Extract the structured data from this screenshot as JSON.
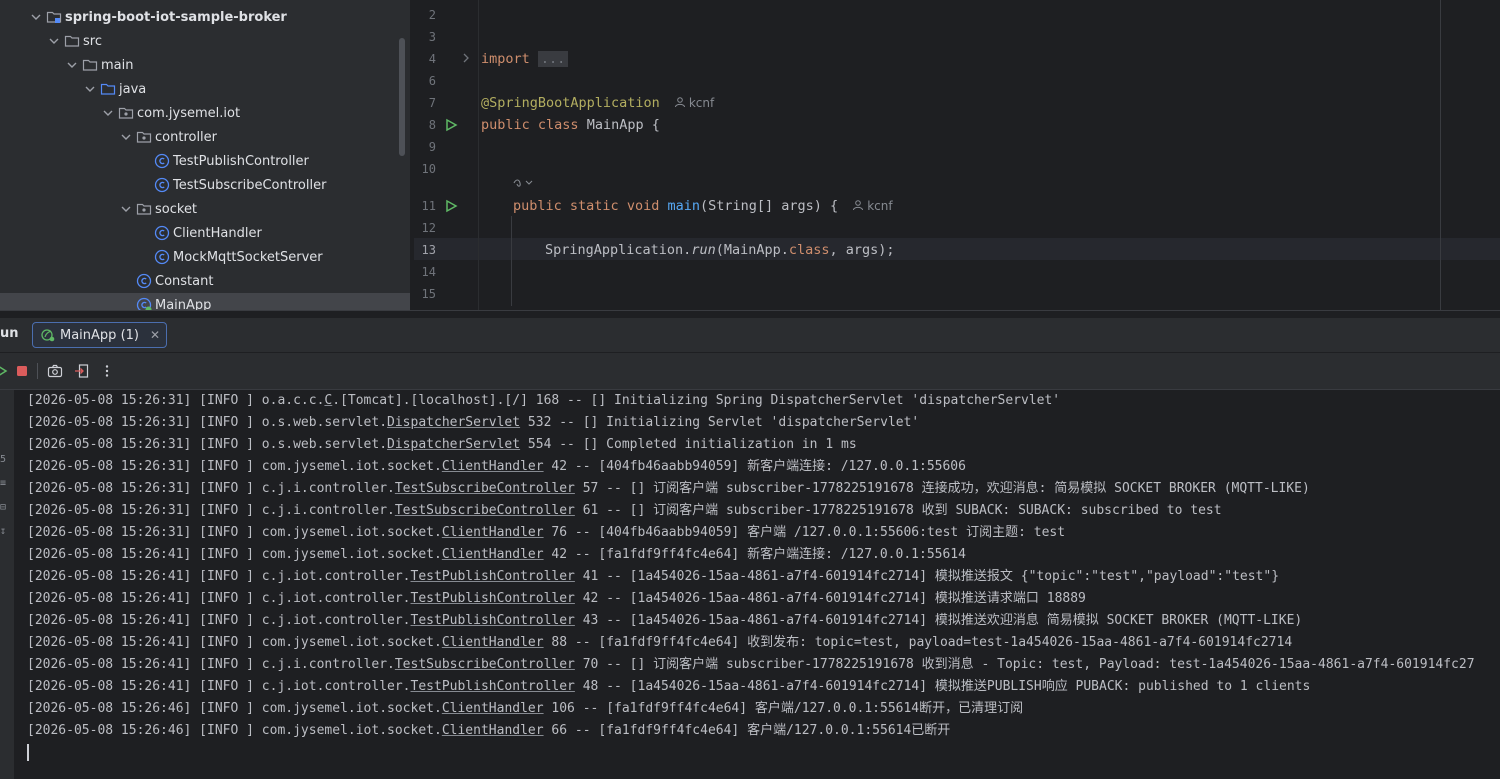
{
  "project_tree": {
    "items": [
      {
        "label": "spring-boot-iot-sample-broker",
        "icon": "module-folder-icon"
      },
      {
        "label": "src",
        "icon": "folder-icon"
      },
      {
        "label": "main",
        "icon": "folder-icon"
      },
      {
        "label": "java",
        "icon": "source-folder-icon"
      },
      {
        "label": "com.jysemel.iot",
        "icon": "package-icon"
      },
      {
        "label": "controller",
        "icon": "package-icon"
      },
      {
        "label": "TestPublishController",
        "icon": "class-icon"
      },
      {
        "label": "TestSubscribeController",
        "icon": "class-icon"
      },
      {
        "label": "socket",
        "icon": "package-icon"
      },
      {
        "label": "ClientHandler",
        "icon": "class-icon"
      },
      {
        "label": "MockMqttSocketServer",
        "icon": "class-icon"
      },
      {
        "label": "Constant",
        "icon": "class-icon"
      },
      {
        "label": "MainApp",
        "icon": "spring-class-icon"
      }
    ]
  },
  "editor": {
    "line_numbers": [
      "2",
      "3",
      "4",
      "6",
      "7",
      "8",
      "9",
      "10",
      "11",
      "12",
      "13",
      "14",
      "15"
    ],
    "import_kw": "import",
    "import_fold": "...",
    "annotation": "@SpringBootApplication",
    "author_hint": "kcnf",
    "class_decl": {
      "public": "public",
      "class": "class",
      "name": " MainApp {"
    },
    "method_decl": {
      "public": "public",
      "static": "static",
      "void": "void",
      "name": "main",
      "params": "(String[] args) {"
    },
    "run_stmt": {
      "obj": "SpringApplication.",
      "method": "run",
      "arg1": "(MainApp.",
      "kw": "class",
      "rest": ", args);"
    }
  },
  "run_window": {
    "title": "un",
    "tab_label": "MainApp (1)",
    "tab_close": "✕"
  },
  "console": {
    "lines": [
      {
        "pre": "[2026-05-08 15:26:31] [INFO ] o.a.c.c.",
        "cls": "C",
        "post": ".[Tomcat].[localhost].[/] 168 -- [] Initializing Spring DispatcherServlet 'dispatcherServlet'"
      },
      {
        "pre": "[2026-05-08 15:26:31] [INFO ] o.s.web.servlet.",
        "cls": "DispatcherServlet",
        "post": " 532 -- [] Initializing Servlet 'dispatcherServlet'"
      },
      {
        "pre": "[2026-05-08 15:26:31] [INFO ] o.s.web.servlet.",
        "cls": "DispatcherServlet",
        "post": " 554 -- [] Completed initialization in 1 ms"
      },
      {
        "pre": "[2026-05-08 15:26:31] [INFO ] com.jysemel.iot.socket.",
        "cls": "ClientHandler",
        "post": " 42 -- [404fb46aabb94059] 新客户端连接: /127.0.0.1:55606"
      },
      {
        "pre": "[2026-05-08 15:26:31] [INFO ] c.j.i.controller.",
        "cls": "TestSubscribeController",
        "post": " 57 -- [] 订阅客户端 subscriber-1778225191678 连接成功，欢迎消息: 简易模拟 SOCKET BROKER (MQTT-LIKE)"
      },
      {
        "pre": "[2026-05-08 15:26:31] [INFO ] c.j.i.controller.",
        "cls": "TestSubscribeController",
        "post": " 61 -- [] 订阅客户端 subscriber-1778225191678 收到 SUBACK: SUBACK: subscribed to test"
      },
      {
        "pre": "[2026-05-08 15:26:31] [INFO ] com.jysemel.iot.socket.",
        "cls": "ClientHandler",
        "post": " 76 -- [404fb46aabb94059] 客户端 /127.0.0.1:55606:test 订阅主题: test"
      },
      {
        "pre": "[2026-05-08 15:26:41] [INFO ] com.jysemel.iot.socket.",
        "cls": "ClientHandler",
        "post": " 42 -- [fa1fdf9ff4fc4e64] 新客户端连接: /127.0.0.1:55614"
      },
      {
        "pre": "[2026-05-08 15:26:41] [INFO ] c.j.iot.controller.",
        "cls": "TestPublishController",
        "post": " 41 -- [1a454026-15aa-4861-a7f4-601914fc2714] 模拟推送报文 {\"topic\":\"test\",\"payload\":\"test\"}"
      },
      {
        "pre": "[2026-05-08 15:26:41] [INFO ] c.j.iot.controller.",
        "cls": "TestPublishController",
        "post": " 42 -- [1a454026-15aa-4861-a7f4-601914fc2714] 模拟推送请求端口 18889"
      },
      {
        "pre": "[2026-05-08 15:26:41] [INFO ] c.j.iot.controller.",
        "cls": "TestPublishController",
        "post": " 43 -- [1a454026-15aa-4861-a7f4-601914fc2714] 模拟推送欢迎消息 简易模拟 SOCKET BROKER (MQTT-LIKE)"
      },
      {
        "pre": "[2026-05-08 15:26:41] [INFO ] com.jysemel.iot.socket.",
        "cls": "ClientHandler",
        "post": " 88 -- [fa1fdf9ff4fc4e64] 收到发布: topic=test, payload=test-1a454026-15aa-4861-a7f4-601914fc2714"
      },
      {
        "pre": "[2026-05-08 15:26:41] [INFO ] c.j.i.controller.",
        "cls": "TestSubscribeController",
        "post": " 70 -- [] 订阅客户端 subscriber-1778225191678 收到消息 - Topic: test, Payload: test-1a454026-15aa-4861-a7f4-601914fc27"
      },
      {
        "pre": "[2026-05-08 15:26:41] [INFO ] c.j.iot.controller.",
        "cls": "TestPublishController",
        "post": " 48 -- [1a454026-15aa-4861-a7f4-601914fc2714] 模拟推送PUBLISH响应 PUBACK: published to 1 clients"
      },
      {
        "pre": "[2026-05-08 15:26:46] [INFO ] com.jysemel.iot.socket.",
        "cls": "ClientHandler",
        "post": " 106 -- [fa1fdf9ff4fc4e64] 客户端/127.0.0.1:55614断开，已清理订阅"
      },
      {
        "pre": "[2026-05-08 15:26:46] [INFO ] com.jysemel.iot.socket.",
        "cls": "ClientHandler",
        "post": " 66 -- [fa1fdf9ff4fc4e64] 客户端/127.0.0.1:55614已断开"
      }
    ],
    "side_glyphs": [
      "5",
      "≡",
      "⊟",
      "↧"
    ]
  },
  "colors": {
    "background": "#1e1f22",
    "panel": "#2b2d30",
    "keyword": "#cf8e6d",
    "annotation": "#b3ae60",
    "function": "#56a8f5",
    "run_green": "#5fb865",
    "stop_red": "#db5c5c",
    "class_icon": "#548af7"
  }
}
